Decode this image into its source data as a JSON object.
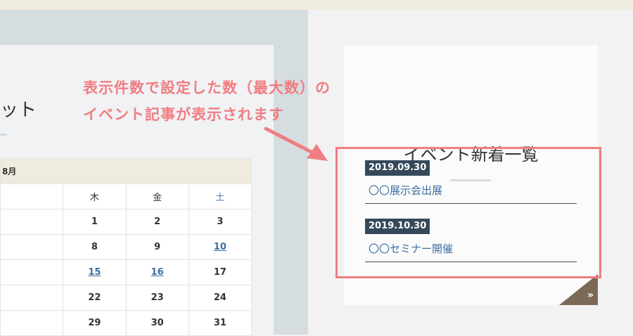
{
  "left_panel": {
    "title_fragment": "ット",
    "calendar": {
      "month_label": "8月",
      "headers": [
        "",
        "木",
        "金",
        "土"
      ],
      "rows": [
        [
          "",
          "1",
          "2",
          "3"
        ],
        [
          "",
          "8",
          "9",
          "10"
        ],
        [
          "",
          "15",
          "16",
          "17"
        ],
        [
          "",
          "22",
          "23",
          "24"
        ],
        [
          "",
          "29",
          "30",
          "31"
        ]
      ]
    }
  },
  "right_panel": {
    "title": "イベント新着一覧",
    "events": [
      {
        "date": "2019.09.30",
        "title": "〇〇展示会出展"
      },
      {
        "date": "2019.10.30",
        "title": "〇〇セミナー開催"
      }
    ],
    "more_symbol": "»"
  },
  "annotation": {
    "line1": "表示件数で設定した数（最大数）の",
    "line2": "イベント記事が表示されます"
  },
  "colors": {
    "accent": "#f07d82",
    "navy": "#35495a",
    "link": "#3c6ea0",
    "corner": "#7a6a55"
  }
}
